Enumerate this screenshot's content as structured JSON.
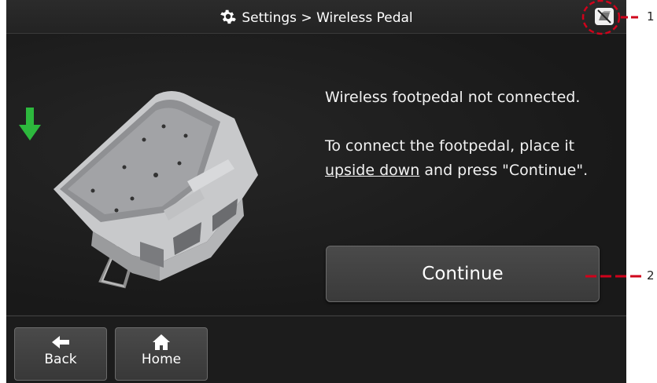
{
  "header": {
    "title": "Settings > Wireless Pedal",
    "title_icon": "gear-icon",
    "status_icon": "wireless-pedal-disconnected-icon"
  },
  "main": {
    "message_line1": "Wireless footpedal not connected.",
    "message_line2_pre": "To connect the footpedal, place it ",
    "message_line2_emph": "upside down",
    "message_line2_post": " and press \"Continue\".",
    "continue_label": "Continue",
    "illustration": "upside-down-footpedal",
    "arrow_icon": "down-arrow-icon",
    "arrow_color": "#2db83d"
  },
  "nav": {
    "back_label": "Back",
    "back_icon": "left-arrow-icon",
    "home_label": "Home",
    "home_icon": "home-icon"
  },
  "callouts": {
    "c1": "1",
    "c2": "2",
    "color": "#d0021b"
  }
}
